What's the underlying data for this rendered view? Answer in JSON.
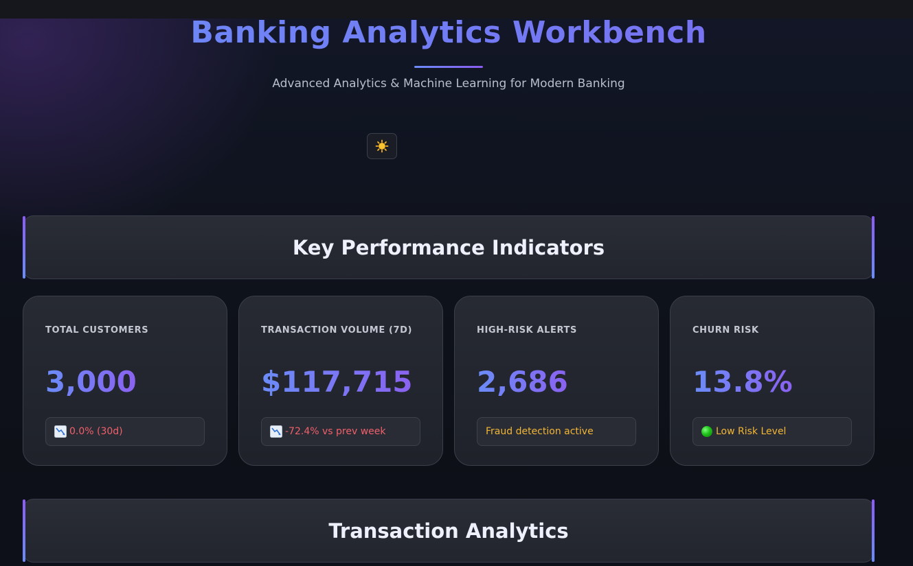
{
  "header": {
    "title": "Banking Analytics Workbench",
    "subtitle": "Advanced Analytics & Machine Learning for Modern Banking",
    "theme_toggle_icon": "sun-icon"
  },
  "sections": {
    "kpi_title": "Key Performance Indicators",
    "transactions_title": "Transaction Analytics"
  },
  "kpis": [
    {
      "label": "TOTAL CUSTOMERS",
      "value": "3,000",
      "delta": "0.0% (30d)",
      "delta_icon": "chart-decreasing-icon",
      "delta_color": "#f0606a"
    },
    {
      "label": "TRANSACTION VOLUME (7D)",
      "value": "$117,715",
      "delta": "-72.4% vs prev week",
      "delta_icon": "chart-decreasing-icon",
      "delta_color": "#f0606a"
    },
    {
      "label": "HIGH-RISK ALERTS",
      "value": "2,686",
      "delta": "Fraud detection active",
      "delta_color": "#f2b534"
    },
    {
      "label": "CHURN RISK",
      "value": "13.8%",
      "delta": "Low Risk Level",
      "delta_icon": "green-circle-icon",
      "delta_color": "#f2b534"
    }
  ],
  "colors": {
    "accent_blue": "#6b8cf8",
    "accent_purple": "#8a5cf0",
    "background": "#0e1119",
    "card": "#252830"
  }
}
